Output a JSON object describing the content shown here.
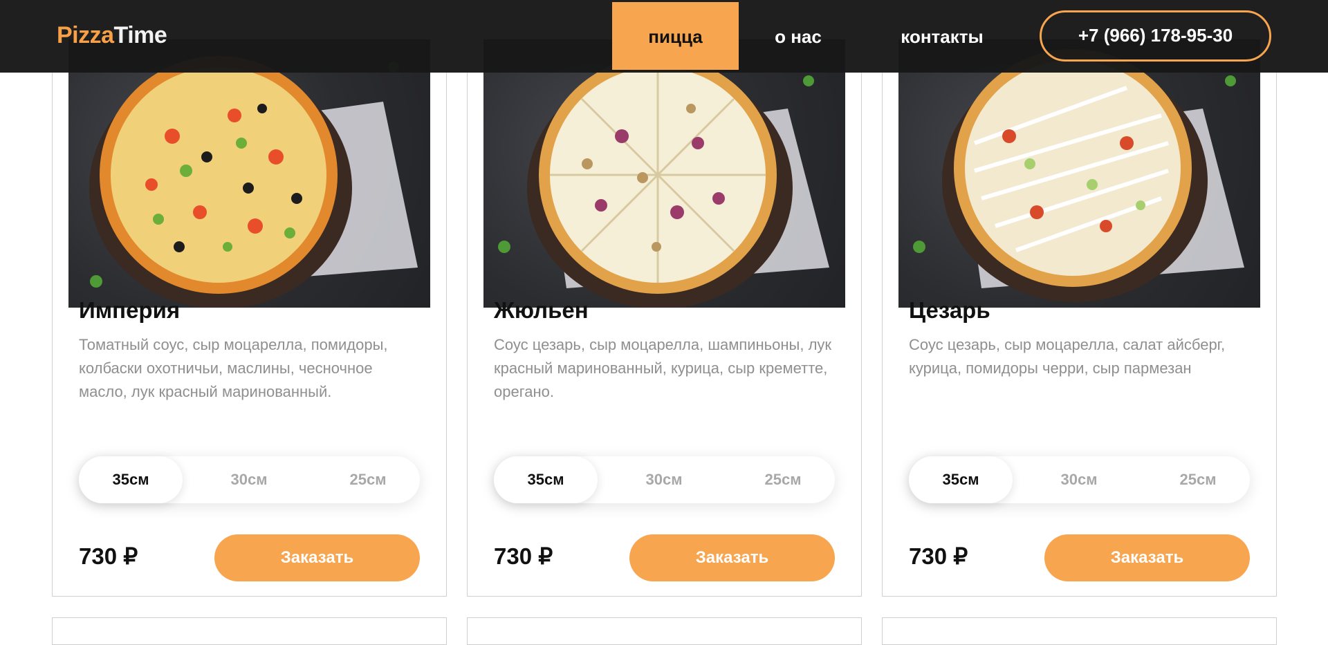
{
  "header": {
    "logo_part1": "Pizza",
    "logo_part2": "Time",
    "nav": {
      "pizza": "пицца",
      "about": "о нас",
      "contacts": "контакты"
    },
    "phone": "+7 (966) 178-95-30",
    "accent_color": "#f8a550"
  },
  "cards": [
    {
      "title": "Империя",
      "description": "Томатный соус, сыр моцарелла, помидоры, колбаски охотничьи, маслины, чесночное масло, лук красный маринованный.",
      "sizes": [
        "35см",
        "30см",
        "25см"
      ],
      "selected_size": "35см",
      "price": "730 ₽",
      "order_label": "Заказать"
    },
    {
      "title": "Жюльен",
      "description": "Соус цезарь, сыр моцарелла, шампиньоны, лук красный маринованный, курица, сыр креметте, орегано.",
      "sizes": [
        "35см",
        "30см",
        "25см"
      ],
      "selected_size": "35см",
      "price": "730 ₽",
      "order_label": "Заказать"
    },
    {
      "title": "Цезарь",
      "description": "Соус цезарь, сыр моцарелла, салат айсберг, курица, помидоры черри, сыр пармезан",
      "sizes": [
        "35см",
        "30см",
        "25см"
      ],
      "selected_size": "35см",
      "price": "730 ₽",
      "order_label": "Заказать"
    }
  ]
}
